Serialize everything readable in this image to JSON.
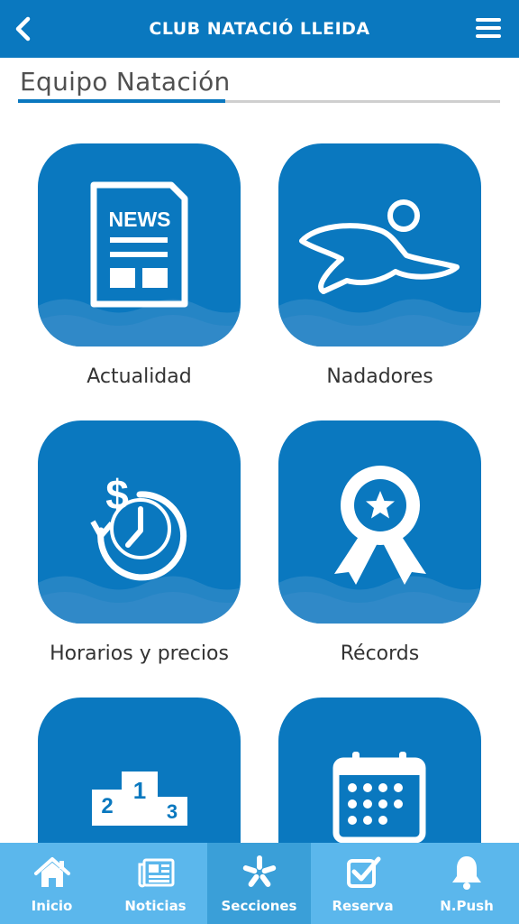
{
  "header": {
    "title": "CLUB NATACIÓ LLEIDA",
    "back_icon": "chevron-left-icon",
    "menu_icon": "hamburger-menu-icon"
  },
  "section": {
    "title": "Equipo Natación"
  },
  "colors": {
    "brand_blue": "#0a78bf",
    "tabbar": "#5bb7ec",
    "tab_active": "#3a9fd8"
  },
  "tiles": [
    {
      "label": "Actualidad",
      "icon": "newspaper-icon",
      "icon_text": "NEWS"
    },
    {
      "label": "Nadadores",
      "icon": "swimmer-icon"
    },
    {
      "label": "Horarios y precios",
      "icon": "price-clock-icon",
      "icon_text": "$"
    },
    {
      "label": "Récords",
      "icon": "award-ribbon-icon"
    },
    {
      "label": "",
      "icon": "podium-icon",
      "icon_text": [
        "1",
        "2",
        "3"
      ]
    },
    {
      "label": "",
      "icon": "calendar-icon"
    }
  ],
  "tabbar": {
    "items": [
      {
        "label": "Inicio",
        "icon": "home-icon",
        "active": false
      },
      {
        "label": "Noticias",
        "icon": "newspaper-icon",
        "active": false
      },
      {
        "label": "Secciones",
        "icon": "sections-icon",
        "active": true
      },
      {
        "label": "Reserva",
        "icon": "checkbox-icon",
        "active": false
      },
      {
        "label": "N.Push",
        "icon": "bell-icon",
        "active": false
      }
    ]
  }
}
